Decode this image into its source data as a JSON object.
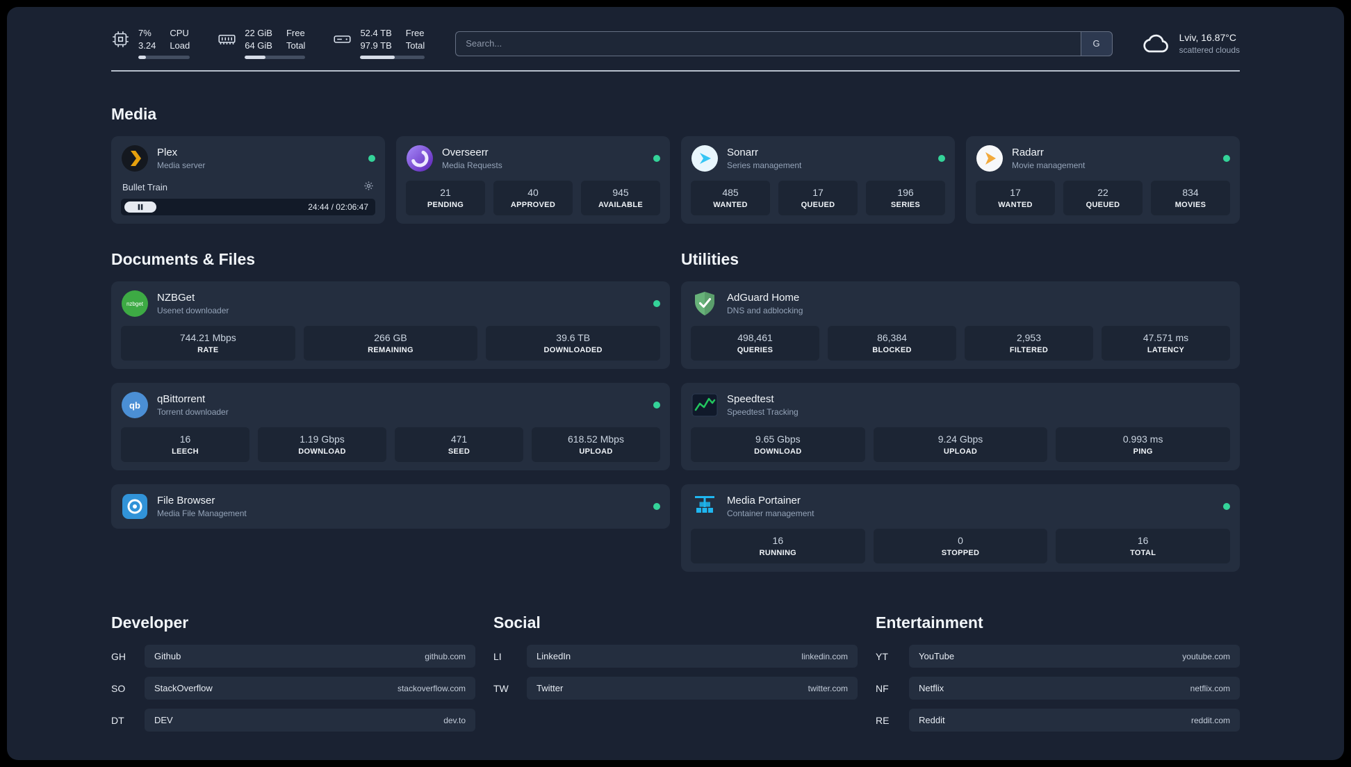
{
  "topbar": {
    "cpu": {
      "value1": "7%",
      "value2": "3.24",
      "label1": "CPU",
      "label2": "Load",
      "bar": 15
    },
    "ram": {
      "value1": "22 GiB",
      "value2": "64 GiB",
      "label1": "Free",
      "label2": "Total",
      "bar": 34
    },
    "disk": {
      "value1": "52.4 TB",
      "value2": "97.9 TB",
      "label1": "Free",
      "label2": "Total",
      "bar": 53
    },
    "search": {
      "placeholder": "Search...",
      "engine_label": "G"
    },
    "weather": {
      "location": "Lviv, 16.87°C",
      "condition": "scattered clouds"
    }
  },
  "media": {
    "title": "Media",
    "plex": {
      "name": "Plex",
      "subtitle": "Media server",
      "now_playing": "Bullet Train",
      "time": "24:44 / 02:06:47",
      "progress": 19
    },
    "overseerr": {
      "name": "Overseerr",
      "subtitle": "Media Requests",
      "stats": [
        {
          "value": "21",
          "label": "PENDING"
        },
        {
          "value": "40",
          "label": "APPROVED"
        },
        {
          "value": "945",
          "label": "AVAILABLE"
        }
      ]
    },
    "sonarr": {
      "name": "Sonarr",
      "subtitle": "Series management",
      "stats": [
        {
          "value": "485",
          "label": "WANTED"
        },
        {
          "value": "17",
          "label": "QUEUED"
        },
        {
          "value": "196",
          "label": "SERIES"
        }
      ]
    },
    "radarr": {
      "name": "Radarr",
      "subtitle": "Movie management",
      "stats": [
        {
          "value": "17",
          "label": "WANTED"
        },
        {
          "value": "22",
          "label": "QUEUED"
        },
        {
          "value": "834",
          "label": "MOVIES"
        }
      ]
    }
  },
  "documents": {
    "title": "Documents & Files",
    "nzbget": {
      "name": "NZBGet",
      "subtitle": "Usenet downloader",
      "stats": [
        {
          "value": "744.21 Mbps",
          "label": "RATE"
        },
        {
          "value": "266 GB",
          "label": "REMAINING"
        },
        {
          "value": "39.6 TB",
          "label": "DOWNLOADED"
        }
      ]
    },
    "qbittorrent": {
      "name": "qBittorrent",
      "subtitle": "Torrent downloader",
      "stats": [
        {
          "value": "16",
          "label": "LEECH"
        },
        {
          "value": "1.19 Gbps",
          "label": "DOWNLOAD"
        },
        {
          "value": "471",
          "label": "SEED"
        },
        {
          "value": "618.52 Mbps",
          "label": "UPLOAD"
        }
      ]
    },
    "filebrowser": {
      "name": "File Browser",
      "subtitle": "Media File Management"
    }
  },
  "utilities": {
    "title": "Utilities",
    "adguard": {
      "name": "AdGuard Home",
      "subtitle": "DNS and adblocking",
      "stats": [
        {
          "value": "498,461",
          "label": "QUERIES"
        },
        {
          "value": "86,384",
          "label": "BLOCKED"
        },
        {
          "value": "2,953",
          "label": "FILTERED"
        },
        {
          "value": "47.571 ms",
          "label": "LATENCY"
        }
      ]
    },
    "speedtest": {
      "name": "Speedtest",
      "subtitle": "Speedtest Tracking",
      "stats": [
        {
          "value": "9.65 Gbps",
          "label": "DOWNLOAD"
        },
        {
          "value": "9.24 Gbps",
          "label": "UPLOAD"
        },
        {
          "value": "0.993 ms",
          "label": "PING"
        }
      ]
    },
    "portainer": {
      "name": "Media Portainer",
      "subtitle": "Container management",
      "stats": [
        {
          "value": "16",
          "label": "RUNNING"
        },
        {
          "value": "0",
          "label": "STOPPED"
        },
        {
          "value": "16",
          "label": "TOTAL"
        }
      ]
    }
  },
  "bookmarks": {
    "developer": {
      "title": "Developer",
      "items": [
        {
          "abbr": "GH",
          "name": "Github",
          "url": "github.com"
        },
        {
          "abbr": "SO",
          "name": "StackOverflow",
          "url": "stackoverflow.com"
        },
        {
          "abbr": "DT",
          "name": "DEV",
          "url": "dev.to"
        }
      ]
    },
    "social": {
      "title": "Social",
      "items": [
        {
          "abbr": "LI",
          "name": "LinkedIn",
          "url": "linkedin.com"
        },
        {
          "abbr": "TW",
          "name": "Twitter",
          "url": "twitter.com"
        }
      ]
    },
    "entertainment": {
      "title": "Entertainment",
      "items": [
        {
          "abbr": "YT",
          "name": "YouTube",
          "url": "youtube.com"
        },
        {
          "abbr": "NF",
          "name": "Netflix",
          "url": "netflix.com"
        },
        {
          "abbr": "RE",
          "name": "Reddit",
          "url": "reddit.com"
        }
      ]
    }
  }
}
